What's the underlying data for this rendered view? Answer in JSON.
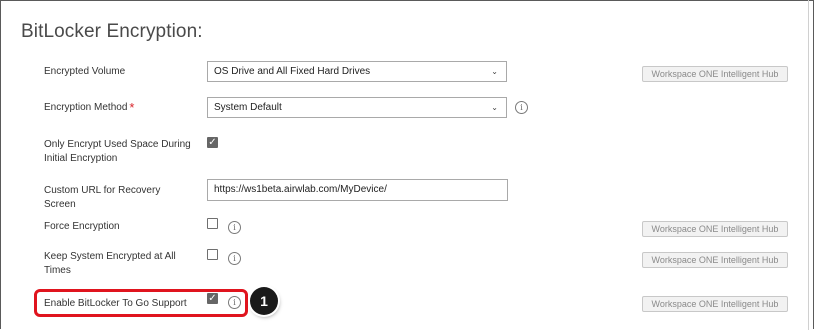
{
  "section": {
    "title": "BitLocker Encryption:"
  },
  "encrypted_volume": {
    "label": "Encrypted Volume",
    "value": "OS Drive and All Fixed Hard Drives"
  },
  "encryption_method": {
    "label": "Encryption Method",
    "required_mark": "*",
    "value": "System Default"
  },
  "only_used_space": {
    "label": "Only Encrypt Used Space During Initial Encryption",
    "checked": true
  },
  "custom_url": {
    "label": "Custom URL for Recovery Screen",
    "value": "https://ws1beta.airwlab.com/MyDevice/"
  },
  "force_encryption": {
    "label": "Force Encryption",
    "checked": false
  },
  "keep_encrypted": {
    "label": "Keep System Encrypted at All Times",
    "checked": false
  },
  "bitlocker_to_go": {
    "label": "Enable BitLocker To Go Support",
    "checked": true
  },
  "hub_badge": {
    "label": "Workspace ONE Intelligent Hub"
  },
  "callout": {
    "number": "1"
  },
  "icons": {
    "info": "info-icon",
    "chevron": "chevron-down-icon",
    "check": "checkmark-icon"
  },
  "colors": {
    "highlight": "#e0141e",
    "required": "#d9242b",
    "callout_bg": "#1a1a1a"
  }
}
